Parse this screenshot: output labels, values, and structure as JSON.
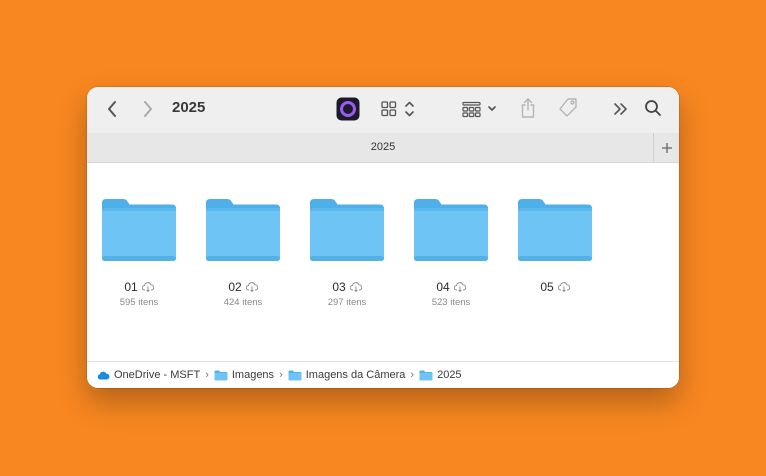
{
  "toolbar": {
    "title": "2025"
  },
  "tab": {
    "label": "2025"
  },
  "items": [
    {
      "name": "01",
      "count": "595 itens"
    },
    {
      "name": "02",
      "count": "424 itens"
    },
    {
      "name": "03",
      "count": "297 itens"
    },
    {
      "name": "04",
      "count": "523 itens"
    },
    {
      "name": "05",
      "count": ""
    }
  ],
  "path": {
    "root": "OneDrive - MSFT",
    "c1": "Imagens",
    "c2": "Imagens da Câmera",
    "c3": "2025"
  },
  "colors": {
    "background": "#F88721",
    "folder": "#6DC4F5",
    "folder_tab": "#4FAFE8",
    "onedrive": "#1A8CE0"
  },
  "icons": [
    "back-icon",
    "forward-icon",
    "app-icon",
    "view-grid-icon",
    "group-icon",
    "share-icon",
    "tag-icon",
    "more-icon",
    "search-icon",
    "cloud-download-icon",
    "folder-icon",
    "onedrive-cloud-icon"
  ]
}
